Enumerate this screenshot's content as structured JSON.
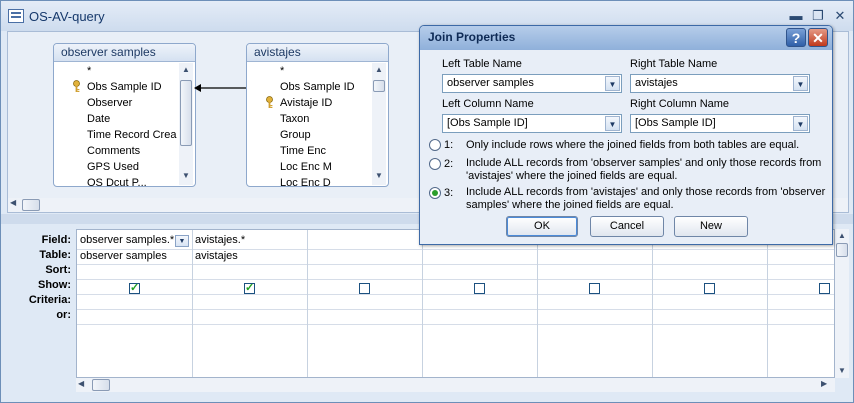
{
  "window": {
    "title": "OS-AV-query"
  },
  "tables": [
    {
      "name": "observer samples",
      "fields": [
        {
          "label": "*",
          "key": false
        },
        {
          "label": "Obs Sample ID",
          "key": true
        },
        {
          "label": "Observer",
          "key": false
        },
        {
          "label": "Date",
          "key": false
        },
        {
          "label": "Time Record Crea",
          "key": false
        },
        {
          "label": "Comments",
          "key": false
        },
        {
          "label": "GPS Used",
          "key": false
        },
        {
          "label": "OS Dcut P...",
          "key": false
        }
      ]
    },
    {
      "name": "avistajes",
      "fields": [
        {
          "label": "*",
          "key": false
        },
        {
          "label": "Obs Sample ID",
          "key": false
        },
        {
          "label": "Avistaje ID",
          "key": true
        },
        {
          "label": "Taxon",
          "key": false
        },
        {
          "label": "Group",
          "key": false
        },
        {
          "label": "Time Enc",
          "key": false
        },
        {
          "label": "Loc Enc M",
          "key": false
        },
        {
          "label": "Loc Enc D",
          "key": false
        }
      ]
    }
  ],
  "grid": {
    "row_labels": [
      "Field:",
      "Table:",
      "Sort:",
      "Show:",
      "Criteria:",
      "or:"
    ],
    "columns": [
      {
        "field": "observer samples.*",
        "table": "observer samples",
        "show": true
      },
      {
        "field": "avistajes.*",
        "table": "avistajes",
        "show": true
      },
      {
        "field": "",
        "table": "",
        "show": false
      },
      {
        "field": "",
        "table": "",
        "show": false
      },
      {
        "field": "",
        "table": "",
        "show": false
      },
      {
        "field": "",
        "table": "",
        "show": false
      },
      {
        "field": "",
        "table": "",
        "show": false
      }
    ]
  },
  "dialog": {
    "title": "Join Properties",
    "help_label": "?",
    "close_label": "✕",
    "left_table_label": "Left Table Name",
    "right_table_label": "Right Table Name",
    "left_table_value": "observer samples",
    "right_table_value": "avistajes",
    "left_column_label": "Left Column Name",
    "right_column_label": "Right Column Name",
    "left_column_value": "[Obs Sample ID]",
    "right_column_value": "[Obs Sample ID]",
    "options": [
      {
        "num": "1:",
        "text": "Only include rows where the joined fields from both tables are equal.",
        "selected": false
      },
      {
        "num": "2:",
        "text": "Include ALL records from 'observer samples' and only those records from 'avistajes' where the joined fields are equal.",
        "selected": false
      },
      {
        "num": "3:",
        "text": "Include ALL records from 'avistajes' and only those records from 'observer samples' where the joined fields are equal.",
        "selected": true
      }
    ],
    "ok_label": "OK",
    "cancel_label": "Cancel",
    "new_label": "New"
  },
  "icons": {
    "key": "key-icon",
    "app": "query-icon"
  },
  "colors": {
    "title_text": "#15386b",
    "dialog_title": "#8fb0da",
    "checkbox_check": "#21a121",
    "radio_selected": "#2b9e2b"
  }
}
